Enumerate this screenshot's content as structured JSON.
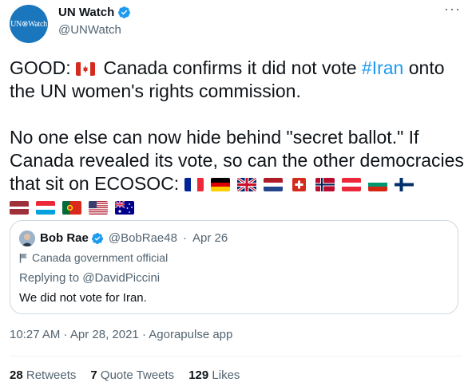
{
  "author": {
    "avatar_text": "UN⊗Watch",
    "display_name": "UN Watch",
    "handle": "@UNWatch"
  },
  "more_label": "···",
  "tweet": {
    "line1_prefix": "GOOD:",
    "line1_rest": " Canada confirms it did not vote ",
    "hashtag": "#Iran",
    "line1_end": " onto the UN women's rights commission.",
    "line2": "No one else can now hide behind \"secret ballot.\" If Canada revealed its vote, so can the other democracies that sit on ECOSOC:"
  },
  "flags": [
    "canada",
    "france",
    "germany",
    "united-kingdom",
    "netherlands",
    "switzerland",
    "norway",
    "austria",
    "bulgaria",
    "finland",
    "latvia",
    "luxembourg",
    "portugal",
    "united-states",
    "australia"
  ],
  "quote": {
    "display_name": "Bob Rae",
    "handle": "@BobRae48",
    "separator": "·",
    "date": "Apr 26",
    "label": "Canada government official",
    "reply_prefix": "Replying to",
    "reply_mention": "@DavidPiccini",
    "text": "We did not vote for Iran."
  },
  "meta": "10:27 AM · Apr 28, 2021 · Agorapulse app",
  "stats": {
    "retweets_count": "28",
    "retweets_label": "Retweets",
    "quotes_count": "7",
    "quotes_label": "Quote Tweets",
    "likes_count": "129",
    "likes_label": "Likes"
  },
  "colors": {
    "link": "#1d9bf0",
    "secondary_text": "#536471",
    "border": "#cfd9de",
    "avatar_bg": "#1b77bd"
  }
}
